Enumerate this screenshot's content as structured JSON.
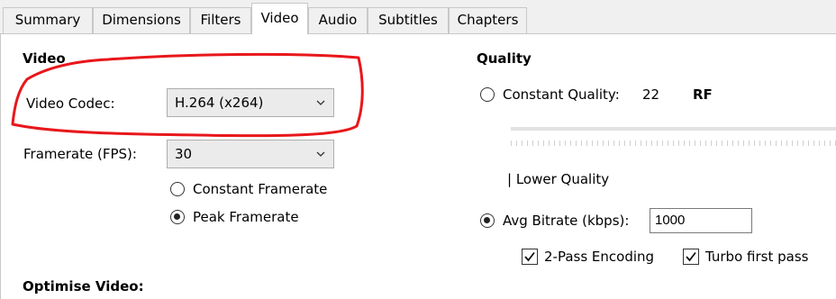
{
  "tabs": [
    {
      "label": "Summary"
    },
    {
      "label": "Dimensions"
    },
    {
      "label": "Filters"
    },
    {
      "label": "Video"
    },
    {
      "label": "Audio"
    },
    {
      "label": "Subtitles"
    },
    {
      "label": "Chapters"
    }
  ],
  "active_tab": "Video",
  "video": {
    "section_title": "Video",
    "codec_label": "Video Codec:",
    "codec_value": "H.264 (x264)",
    "framerate_label": "Framerate (FPS):",
    "framerate_value": "30",
    "constant_framerate_label": "Constant Framerate",
    "peak_framerate_label": "Peak Framerate",
    "peak_framerate_selected": true
  },
  "quality": {
    "section_title": "Quality",
    "constant_quality_label": "Constant Quality:",
    "constant_quality_value": "22",
    "rf_label": "RF",
    "lower_quality_label": "| Lower Quality",
    "avg_bitrate_label": "Avg Bitrate (kbps):",
    "avg_bitrate_value": "1000",
    "avg_bitrate_selected": true,
    "two_pass_label": "2-Pass Encoding",
    "two_pass_checked": true,
    "turbo_first_pass_label": "Turbo first pass",
    "turbo_first_pass_checked": true
  },
  "optimise": {
    "section_title": "Optimise Video:"
  },
  "colors": {
    "annotation": "#e8171b",
    "tab_border": "#c8c8c8",
    "combo_bg": "#ebebeb"
  }
}
